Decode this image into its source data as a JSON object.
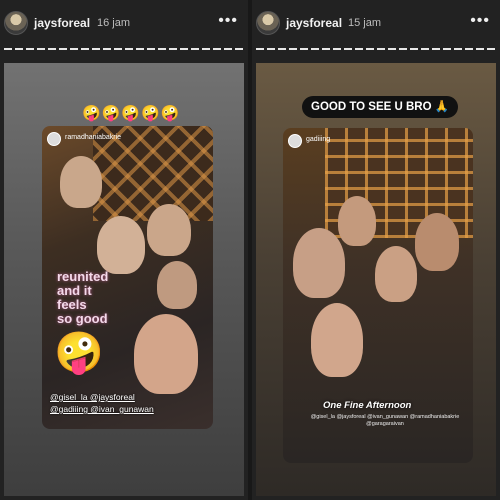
{
  "stories": [
    {
      "username": "jaysforeal",
      "time": "16 jam",
      "menu_icon": "•••",
      "emoji_row": "🤪🤪🤪🤪🤪",
      "repost_username": "ramadhaniabakrie",
      "sticker_text": [
        "reunited",
        "and it",
        "feels",
        "so good"
      ],
      "big_emoji": "🤪",
      "mentions": [
        "@gisel_la @jaysforeal",
        "@gadiiing @ivan_gunawan"
      ]
    },
    {
      "username": "jaysforeal",
      "time": "15 jam",
      "menu_icon": "•••",
      "pill_text": "GOOD TO SEE U BRO 🙏",
      "repost_username": "gadiiing",
      "caption": "One Fine Afternoon",
      "tags": "@gisel_la @jaysforeal @ivan_gunawan @ramadhaniabakrie @garagaraivan"
    }
  ],
  "colors": {
    "background": "#1e1e1e",
    "text": "#ffffff",
    "time": "#bdbdbd"
  }
}
